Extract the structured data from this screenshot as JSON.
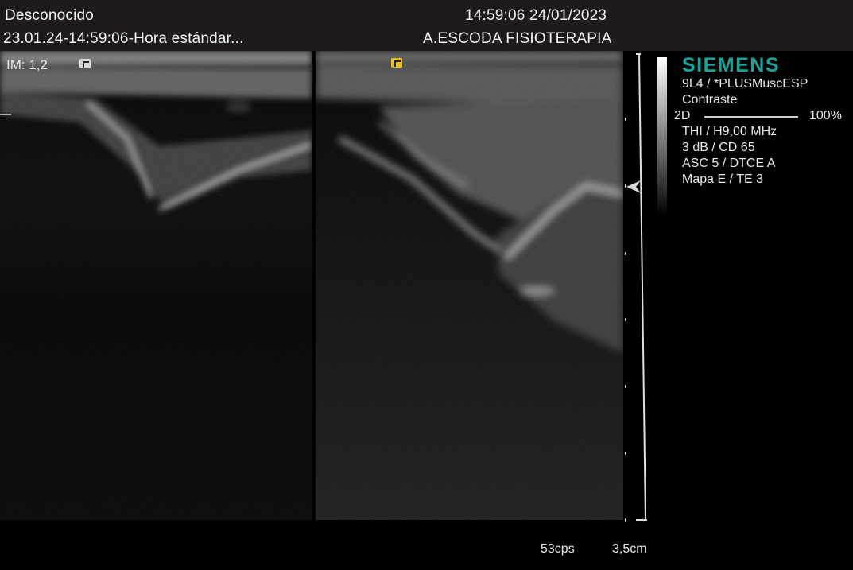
{
  "header": {
    "patient": "Desconocido",
    "study": "23.01.24-14:59:06-Hora estándar...",
    "datetime": "14:59:06 24/01/2023",
    "institution": "A.ESCODA FISIOTERAPIA"
  },
  "image": {
    "im_label": "IM:  1,2",
    "left_marker_color": "#d7d7d7",
    "right_marker_color": "#e6c21e"
  },
  "panel": {
    "brand": "SIEMENS",
    "brand_color": "#17a59a",
    "transducer": "9L4 / *PLUSMuscESP",
    "preset": "Contraste",
    "mode": "2D",
    "mode_power": "100%",
    "thi": "THI / H9,00 MHz",
    "gain": "3 dB / CD 65",
    "asc": "ASC 5 / DTCE A",
    "map": "Mapa E / TE 3"
  },
  "footer": {
    "frame_rate": "53cps",
    "depth": "3,5cm"
  }
}
